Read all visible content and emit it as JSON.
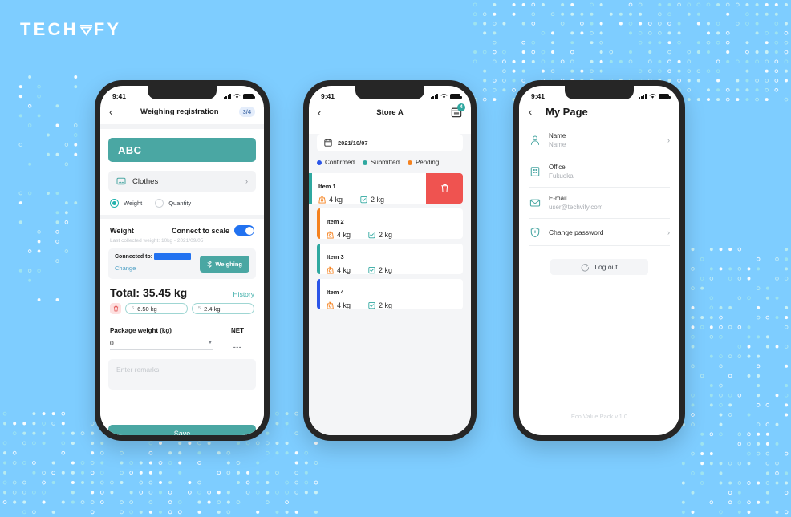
{
  "brand": {
    "logo_text_part1": "TECH",
    "logo_text_part2": "FY",
    "logo_v": "V"
  },
  "colors": {
    "page_background": "#7ecdff",
    "accent_teal": "#4aa7a3",
    "accent_cyan": "#21b3ad",
    "toggle_blue": "#2272f0",
    "danger_red": "#ef5350",
    "status_confirmed": "#2b55e8",
    "status_submitted": "#2fa8a0",
    "status_pending": "#f5821f"
  },
  "phone1": {
    "status_bar": {
      "time": "9:41"
    },
    "nav": {
      "back": "‹",
      "title": "Weighing registration",
      "page_count": "3/4"
    },
    "name_banner": "ABC",
    "category": {
      "label": "Clothes",
      "chevron": "›",
      "icon": "image-icon"
    },
    "options": [
      {
        "label": "Weight",
        "selected": true
      },
      {
        "label": "Quantity",
        "selected": false
      }
    ],
    "weight_section": {
      "label": "Weight",
      "connect_label": "Connect to scale",
      "toggle_on": true,
      "last_collected": "Last collected weight: 10kg - 2021/09/05"
    },
    "connection": {
      "connected_to_label": "Connected to:",
      "device_redacted": true,
      "change_link": "Change",
      "weigh_button": "Weighing",
      "bluetooth_icon": "bluetooth-icon"
    },
    "total": {
      "text": "Total: 35.45 kg",
      "history_link": "History"
    },
    "measurements": [
      {
        "index": "6",
        "value": "6.50 kg"
      },
      {
        "index": "5",
        "value": "2.4 kg"
      }
    ],
    "package": {
      "label": "Package weight (kg)",
      "value": "0"
    },
    "net": {
      "label": "NET",
      "value": "---"
    },
    "remarks_placeholder": "Enter remarks",
    "save_button": "Save"
  },
  "phone2": {
    "status_bar": {
      "time": "9:41"
    },
    "nav": {
      "back": "‹",
      "title": "Store A",
      "badge_count": "4",
      "badge_icon": "calendar-list-icon"
    },
    "date": {
      "value": "2021/10/07",
      "icon": "calendar-icon"
    },
    "legend": [
      {
        "label": "Confirmed",
        "color": "#2b55e8"
      },
      {
        "label": "Submitted",
        "color": "#2fa8a0"
      },
      {
        "label": "Pending",
        "color": "#f5821f"
      }
    ],
    "delete_action": {
      "icon": "trash-icon"
    },
    "items": [
      {
        "title": "Item 1",
        "weight": "4 kg",
        "quantity": "2 kg",
        "stripe": "#2fa8a0",
        "swiped": true
      },
      {
        "title": "Item 2",
        "weight": "4 kg",
        "quantity": "2 kg",
        "stripe": "#f5821f",
        "swiped": false
      },
      {
        "title": "Item 3",
        "weight": "4 kg",
        "quantity": "2 kg",
        "stripe": "#2fa8a0",
        "swiped": false
      },
      {
        "title": "Item 4",
        "weight": "4 kg",
        "quantity": "2 kg",
        "stripe": "#2b55e8",
        "swiped": false
      }
    ]
  },
  "phone3": {
    "status_bar": {
      "time": "9:41"
    },
    "nav": {
      "back": "‹",
      "title": "My Page"
    },
    "rows": [
      {
        "icon": "person-icon",
        "label": "Name",
        "value": "Name",
        "chevron": "›"
      },
      {
        "icon": "office-building-icon",
        "label": "Office",
        "value": "Fukuoka",
        "chevron": ""
      },
      {
        "icon": "mail-icon",
        "label": "E-mail",
        "value": "user@techvify.com",
        "chevron": ""
      },
      {
        "icon": "shield-lock-icon",
        "label": "Change password",
        "value": "",
        "chevron": "›"
      }
    ],
    "logout_button": "Log out",
    "logout_icon": "logout-icon",
    "version": "Eco Value Pack v.1.0"
  }
}
